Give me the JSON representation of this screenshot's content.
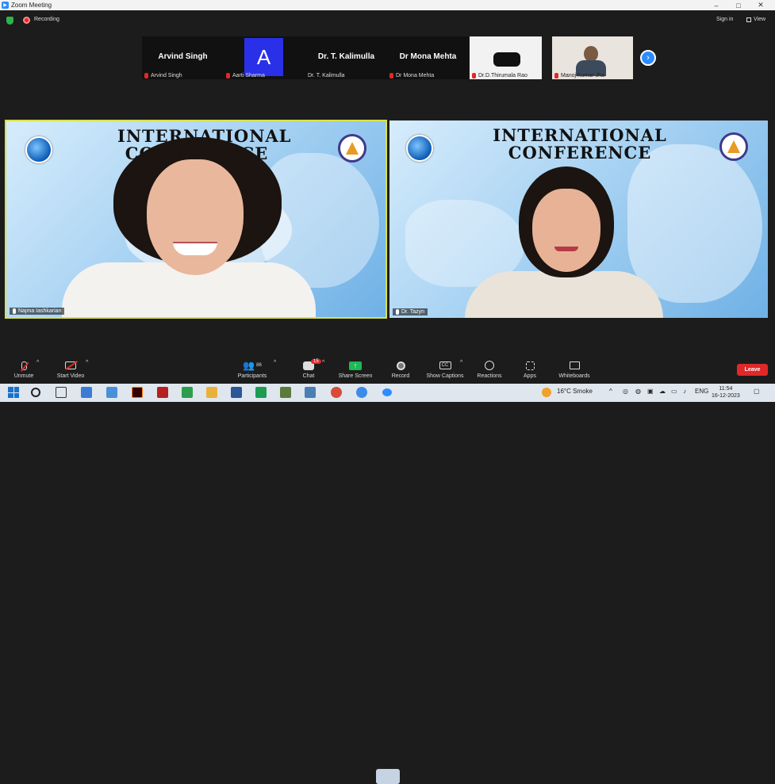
{
  "window": {
    "title": "Zoom Meeting",
    "minimize": "–",
    "maximize": "□",
    "close": "✕"
  },
  "topbar": {
    "recording_label": "Recording",
    "signin_label": "Sign in",
    "view_label": "View"
  },
  "strip": {
    "tiles": [
      {
        "display": "Arvind Singh",
        "name": "Arvind Singh"
      },
      {
        "display": "A",
        "name": "Aarti Sharma"
      },
      {
        "display": "Dr. T. Kalimulla",
        "name": "Dr. T. Kalimulla"
      },
      {
        "display": "Dr Mona Mehta",
        "name": "Dr Mona Mehta"
      },
      {
        "display": "",
        "name": "Dr.D.Thirumala Rao"
      },
      {
        "display": "",
        "name": "Manoj Kumar Jha"
      }
    ],
    "next_glyph": "›"
  },
  "main": {
    "left": {
      "conf_title": "INTERNATIONAL\nCONFERENCE",
      "name": "Najma Iashkarian"
    },
    "right": {
      "conf_title": "INTERNATIONAL\nCONFERENCE",
      "name": "Dr. Tazyn"
    }
  },
  "toolbar": {
    "items": [
      {
        "label": "Unmute",
        "icon": "mic-muted-icon"
      },
      {
        "label": "Start Video",
        "icon": "video-off-icon"
      },
      {
        "label": "Participants",
        "count": "86",
        "icon": "participants-icon"
      },
      {
        "label": "Chat",
        "badge": "15",
        "icon": "chat-icon"
      },
      {
        "label": "Share Screen",
        "icon": "share-screen-icon"
      },
      {
        "label": "Record",
        "icon": "record-icon"
      },
      {
        "label": "Show Captions",
        "icon": "captions-icon"
      },
      {
        "label": "Reactions",
        "icon": "reactions-icon"
      },
      {
        "label": "Apps",
        "icon": "apps-icon"
      },
      {
        "label": "Whiteboards",
        "icon": "whiteboard-icon"
      }
    ],
    "leave_label": "Leave"
  },
  "taskbar": {
    "weather": "16°C Smoke",
    "language": "ENG",
    "time": "11:54",
    "date": "16-12-2023"
  },
  "colors": {
    "accent": "#2d8cff",
    "danger": "#e02828",
    "share": "#1db954",
    "active_speaker": "#d7e24a"
  }
}
